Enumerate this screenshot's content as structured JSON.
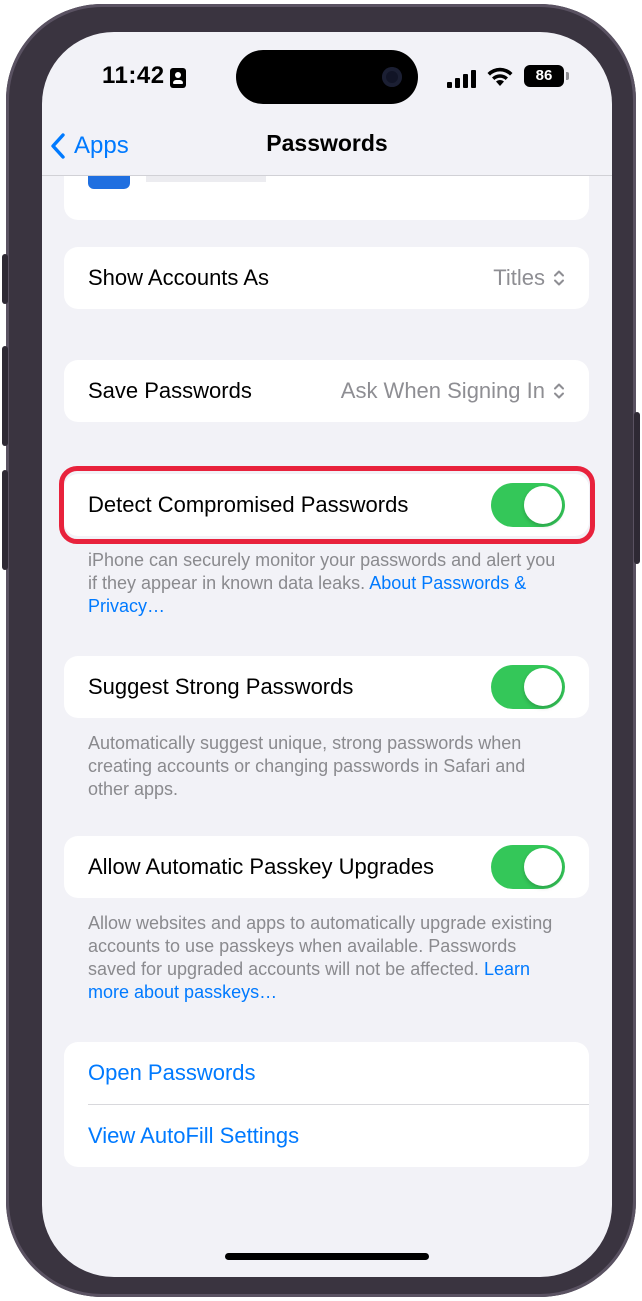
{
  "status_bar": {
    "time": "11:42",
    "battery": "86",
    "icons": [
      "contact-card-icon",
      "cellular-signal-icon",
      "wifi-icon",
      "battery-icon"
    ]
  },
  "nav": {
    "back_label": "Apps",
    "title": "Passwords"
  },
  "settings": {
    "show_accounts_as": {
      "label": "Show Accounts As",
      "value": "Titles"
    },
    "save_passwords": {
      "label": "Save Passwords",
      "value": "Ask When Signing In"
    },
    "detect_compromised": {
      "label": "Detect Compromised Passwords",
      "on": true,
      "footer": "iPhone can securely monitor your passwords and alert you if they appear in known data leaks.",
      "footer_link": "About Passwords & Privacy…"
    },
    "suggest_strong": {
      "label": "Suggest Strong Passwords",
      "on": true,
      "footer": "Automatically suggest unique, strong passwords when creating accounts or changing passwords in Safari and other apps."
    },
    "passkey_upgrades": {
      "label": "Allow Automatic Passkey Upgrades",
      "on": true,
      "footer": "Allow websites and apps to automatically upgrade existing accounts to use passkeys when available. Passwords saved for upgraded accounts will not be affected.",
      "footer_link": "Learn more about passkeys…"
    },
    "links": {
      "open_passwords": "Open Passwords",
      "view_autofill": "View AutoFill Settings"
    }
  },
  "colors": {
    "accent": "#007aff",
    "toggle_on": "#34c759",
    "highlight": "#e8223c",
    "background": "#f2f2f7"
  }
}
